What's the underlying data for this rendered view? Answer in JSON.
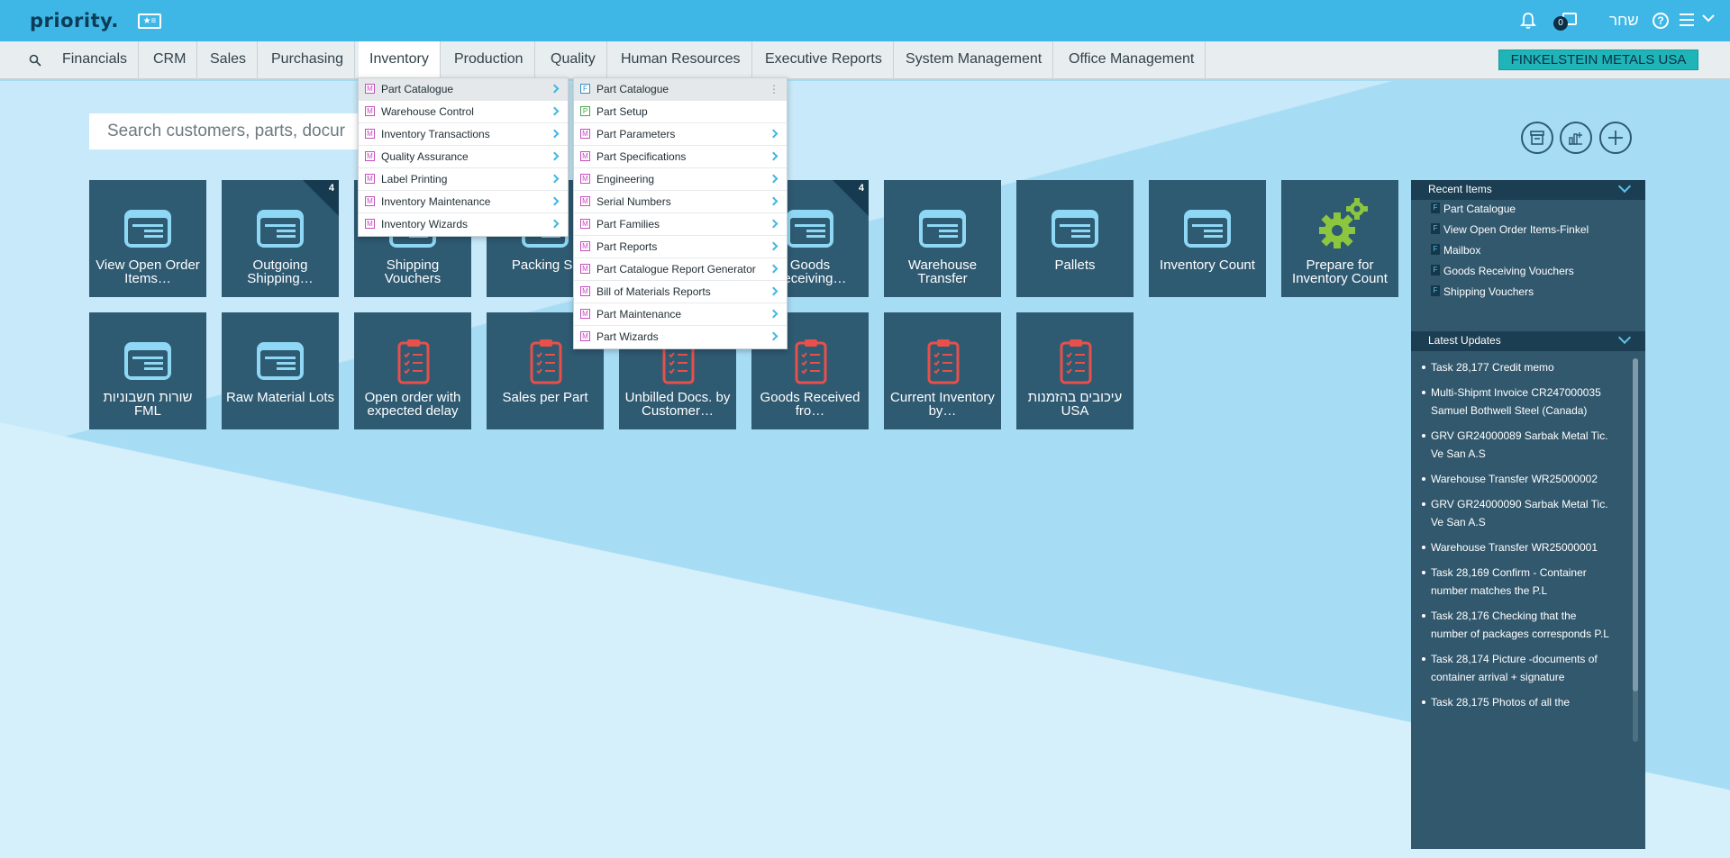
{
  "app": {
    "logo": "priority.",
    "user_name": "שחר",
    "notif_count": "0",
    "help_label": "?"
  },
  "nav": {
    "items": [
      "Financials",
      "CRM",
      "Sales",
      "Purchasing",
      "Inventory",
      "Production",
      "Quality",
      "Human Resources",
      "Executive Reports",
      "System Management",
      "Office Management"
    ],
    "active": "Inventory",
    "company": "FINKELSTEIN METALS USA"
  },
  "search": {
    "placeholder": "Search customers, parts, docur"
  },
  "menu1": [
    {
      "badge": "M",
      "label": "Part Catalogue"
    },
    {
      "badge": "M",
      "label": "Warehouse Control"
    },
    {
      "badge": "M",
      "label": "Inventory Transactions"
    },
    {
      "badge": "M",
      "label": "Quality Assurance"
    },
    {
      "badge": "M",
      "label": "Label Printing"
    },
    {
      "badge": "M",
      "label": "Inventory Maintenance"
    },
    {
      "badge": "M",
      "label": "Inventory Wizards"
    }
  ],
  "menu2": [
    {
      "badge": "F",
      "label": "Part Catalogue"
    },
    {
      "badge": "P",
      "label": "Part Setup"
    },
    {
      "badge": "M",
      "label": "Part Parameters"
    },
    {
      "badge": "M",
      "label": "Part Specifications"
    },
    {
      "badge": "M",
      "label": "Engineering"
    },
    {
      "badge": "M",
      "label": "Serial Numbers"
    },
    {
      "badge": "M",
      "label": "Part Families"
    },
    {
      "badge": "M",
      "label": "Part Reports"
    },
    {
      "badge": "M",
      "label": "Part Catalogue Report Generator"
    },
    {
      "badge": "M",
      "label": "Bill of Materials Reports"
    },
    {
      "badge": "M",
      "label": "Part Maintenance"
    },
    {
      "badge": "M",
      "label": "Part Wizards"
    }
  ],
  "tiles_row1": [
    {
      "label": "View Open Order Items…",
      "count": ""
    },
    {
      "label": "Outgoing Shipping…",
      "count": "4"
    },
    {
      "label": "Shipping Vouchers",
      "count": ""
    },
    {
      "label": "Packing Sli",
      "count": ""
    },
    {
      "label": "",
      "count": ""
    },
    {
      "label": "Goods Receiving…",
      "count": "4"
    },
    {
      "label": "Warehouse Transfer",
      "count": ""
    },
    {
      "label": "Pallets",
      "count": ""
    },
    {
      "label": "Inventory Count",
      "count": ""
    },
    {
      "label": "Prepare for Inventory Count",
      "count": ""
    }
  ],
  "tiles_row2": [
    {
      "label": "שורות חשבוניות FML",
      "icon": "form-icon"
    },
    {
      "label": "Raw Material Lots",
      "icon": "form-icon"
    },
    {
      "label": "Open order with expected delay",
      "icon": "clipboard-icon"
    },
    {
      "label": "Sales per Part",
      "icon": "clipboard-icon"
    },
    {
      "label": "Unbilled Docs. by Customer…",
      "icon": "clipboard-icon"
    },
    {
      "label": "Goods Received fro…",
      "icon": "clipboard-icon"
    },
    {
      "label": "Current Inventory by…",
      "icon": "clipboard-icon"
    },
    {
      "label": "עיכובים בהזמנות USA",
      "icon": "clipboard-icon"
    }
  ],
  "recent": {
    "title": "Recent Items",
    "items": [
      "Part Catalogue",
      "View Open Order Items-Finkel",
      "Mailbox",
      "Goods Receiving Vouchers",
      "Shipping Vouchers"
    ]
  },
  "updates": {
    "title": "Latest Updates",
    "items": [
      "Task 28,177 Credit memo",
      "Multi-Shipmt Invoice CR247000035 Samuel Bothwell Steel (Canada)",
      "GRV GR24000089 Sarbak Metal Tic. Ve San A.S",
      "Warehouse Transfer WR25000002",
      "GRV GR24000090 Sarbak Metal Tic. Ve San A.S",
      "Warehouse Transfer WR25000001",
      "Task 28,169 Confirm - Container number matches the P.L",
      "Task 28,176 Checking that the number of packages corresponds P.L",
      "Task 28,174 Picture -documents of container arrival + signature",
      "Task 28,175 Photos of all the"
    ]
  },
  "colors": {
    "topbar": "#3fb7e6",
    "tile": "#2e5a72",
    "accent": "#1fb5b8",
    "clipboard": "#e8504a",
    "gear": "#8cc63f"
  }
}
